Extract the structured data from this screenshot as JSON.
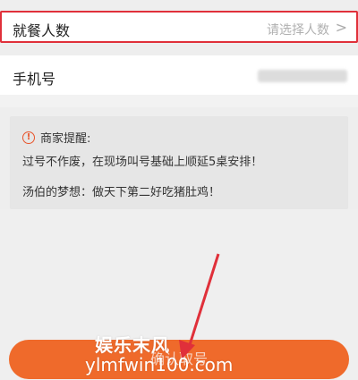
{
  "form": {
    "diners_label": "就餐人数",
    "diners_hint": "请选择人数",
    "diners_chevron": ">",
    "phone_label": "手机号"
  },
  "notice": {
    "title": "商家提醒:",
    "line1": "过号不作废，在现场叫号基础上顺延5桌安排！",
    "line2": "汤伯的梦想：做天下第二好吃猪肚鸡！"
  },
  "confirm_button": "确认取号",
  "watermark": {
    "line1": "娱乐末风",
    "line2": "ylmfwin100.com"
  },
  "colors": {
    "accent": "#ef6a2b",
    "highlight_border": "#e0303a",
    "arrow": "#e0303a"
  }
}
